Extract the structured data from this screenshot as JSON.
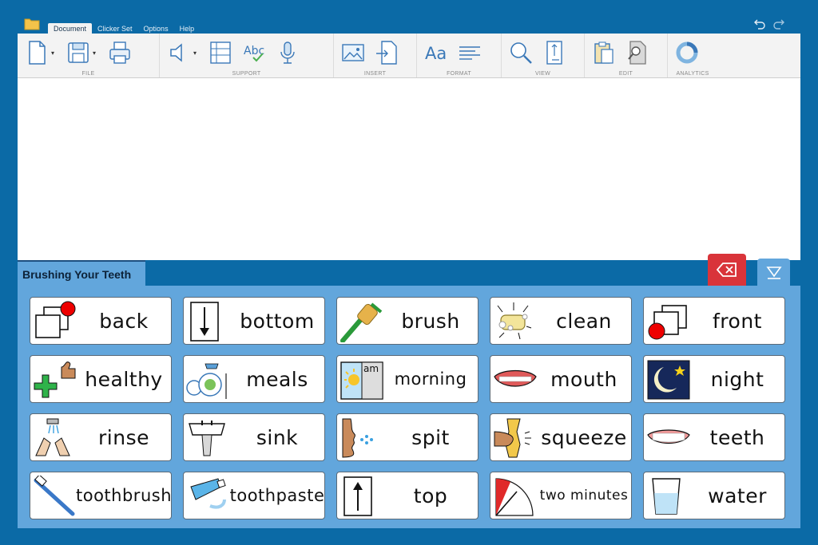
{
  "menubar": {
    "tabs": [
      {
        "label": "Document",
        "active": true
      },
      {
        "label": "Clicker Set",
        "active": false
      },
      {
        "label": "Options",
        "active": false
      },
      {
        "label": "Help",
        "active": false
      }
    ]
  },
  "ribbon": {
    "groups": {
      "file": "FILE",
      "support": "SUPPORT",
      "insert": "INSERT",
      "format": "FORMAT",
      "view": "VIEW",
      "edit": "EDIT",
      "analytics": "ANALYTICS"
    },
    "spellcheck_text": "Abc",
    "format_text": "Aa"
  },
  "set": {
    "title": "Brushing Your Teeth"
  },
  "cells": [
    {
      "word": "back",
      "icon": "back-icon"
    },
    {
      "word": "bottom",
      "icon": "bottom-arrow-icon"
    },
    {
      "word": "brush",
      "icon": "brush-icon"
    },
    {
      "word": "clean",
      "icon": "soap-icon"
    },
    {
      "word": "front",
      "icon": "front-icon"
    },
    {
      "word": "healthy",
      "icon": "healthy-icon"
    },
    {
      "word": "meals",
      "icon": "meals-icon"
    },
    {
      "word": "morning",
      "icon": "morning-icon",
      "badge": "am"
    },
    {
      "word": "mouth",
      "icon": "mouth-icon"
    },
    {
      "word": "night",
      "icon": "night-icon"
    },
    {
      "word": "rinse",
      "icon": "rinse-hands-icon"
    },
    {
      "word": "sink",
      "icon": "sink-icon"
    },
    {
      "word": "spit",
      "icon": "spit-icon"
    },
    {
      "word": "squeeze",
      "icon": "squeeze-icon"
    },
    {
      "word": "teeth",
      "icon": "teeth-icon"
    },
    {
      "word": "toothbrush",
      "icon": "toothbrush-icon"
    },
    {
      "word": "toothpaste",
      "icon": "toothpaste-icon"
    },
    {
      "word": "top",
      "icon": "top-arrow-icon"
    },
    {
      "word": "two minutes",
      "icon": "timer-icon"
    },
    {
      "word": "water",
      "icon": "water-glass-icon"
    }
  ],
  "colors": {
    "background": "#0b6aa6",
    "panel": "#62a6dc",
    "delete": "#d9343a"
  }
}
